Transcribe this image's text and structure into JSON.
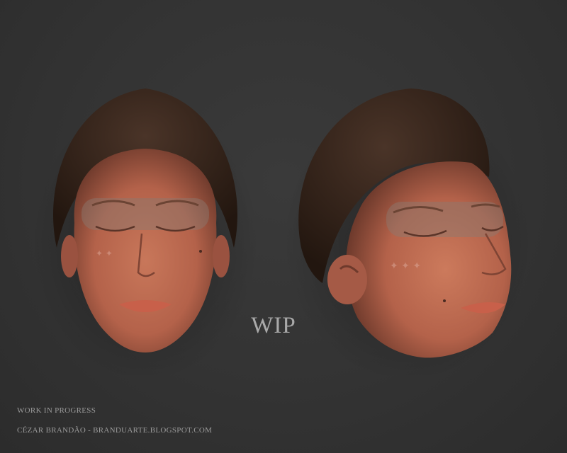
{
  "caption": {
    "wip": "WIP",
    "status_line": "WORK IN PROGRESS",
    "credit_line": "CÉZAR BRANDÃO - BRANDUARTE.BLOGSPOT.COM"
  },
  "renders": [
    {
      "name": "front view",
      "description": "sculpted female head, eyes closed"
    },
    {
      "name": "three-quarter view",
      "description": "sculpted female head, eyes closed"
    }
  ],
  "colors": {
    "background": "#333333",
    "skin": "#c46b4f",
    "hair": "#3a2a22",
    "text": "#9b9b9b"
  }
}
